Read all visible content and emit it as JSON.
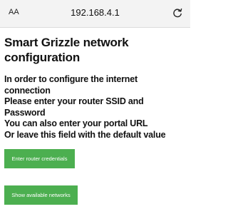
{
  "browser": {
    "text_size_label": "AA",
    "url": "192.168.4.1",
    "reload_icon": "reload-icon"
  },
  "page": {
    "title": "Smart Grizzle network configuration",
    "lines": [
      "In order to configure the internet",
      "connection",
      "Please enter your router SSID and",
      "Password",
      "You can also enter your portal URL",
      "Or leave this field with the default value"
    ],
    "buttons": {
      "credentials": "Enter router credentials",
      "networks": "Show available networks"
    }
  },
  "colors": {
    "button_bg": "#4caf50",
    "button_text": "#ffffff",
    "toolbar_bg": "#f3f3f3"
  }
}
